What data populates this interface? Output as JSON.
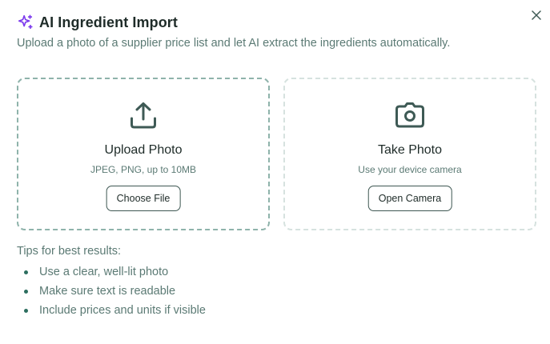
{
  "dialog": {
    "title": "AI Ingredient Import",
    "subtitle": "Upload a photo of a supplier price list and let AI extract the ingredients automatically.",
    "title_icon": "sparkles-icon",
    "close_icon": "close-icon"
  },
  "options": {
    "upload": {
      "icon": "upload-icon",
      "title": "Upload Photo",
      "subtitle": "JPEG, PNG, up to 10MB",
      "button_label": "Choose File"
    },
    "camera": {
      "icon": "camera-icon",
      "title": "Take Photo",
      "subtitle": "Use your device camera",
      "button_label": "Open Camera"
    }
  },
  "tips": {
    "heading": "Tips for best results:",
    "items": [
      "Use a clear, well-lit photo",
      "Make sure text is readable",
      "Include prices and units if visible"
    ]
  },
  "colors": {
    "accent_purple": "#7c3aed",
    "brand_dark_green": "#3e5a55",
    "muted_text": "#5b7a74",
    "upload_border": "#8fb3ab",
    "camera_border": "#d6e2df",
    "bullet": "#2c6e5f"
  }
}
